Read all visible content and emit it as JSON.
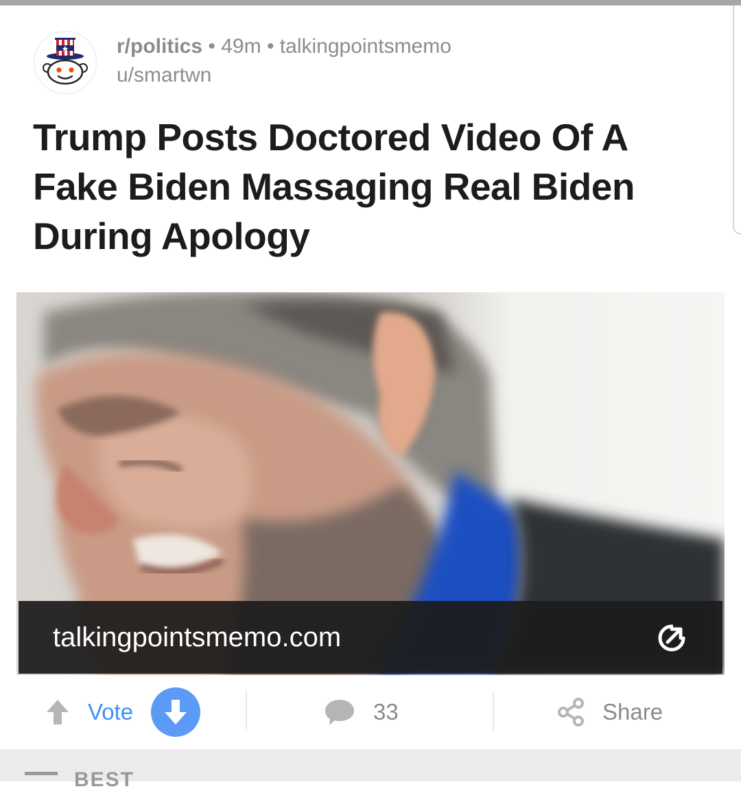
{
  "post": {
    "subreddit": "r/politics",
    "time_ago": "49m",
    "domain_short": "talkingpointsmemo",
    "separator": "•",
    "author": "u/smartwn",
    "title": "Trump Posts Doctored Video Of A Fake Biden Massaging Real Biden During Apology"
  },
  "media": {
    "link_domain": "talkingpointsmemo.com"
  },
  "actions": {
    "vote_label": "Vote",
    "comment_count": "33",
    "share_label": "Share"
  },
  "next_section": {
    "label": "BEST"
  },
  "colors": {
    "accent_blue": "#3f8ef6",
    "downvote_blue": "#5b9af7",
    "title_text": "#1c1c1c",
    "meta_gray": "#8c8c8c"
  },
  "icons": {
    "subreddit": "snoo-uncle-sam-icon",
    "upvote": "arrow-up-icon",
    "downvote": "arrow-down-icon",
    "comments": "comment-bubble-icon",
    "share": "share-icon",
    "external": "external-link-icon"
  }
}
